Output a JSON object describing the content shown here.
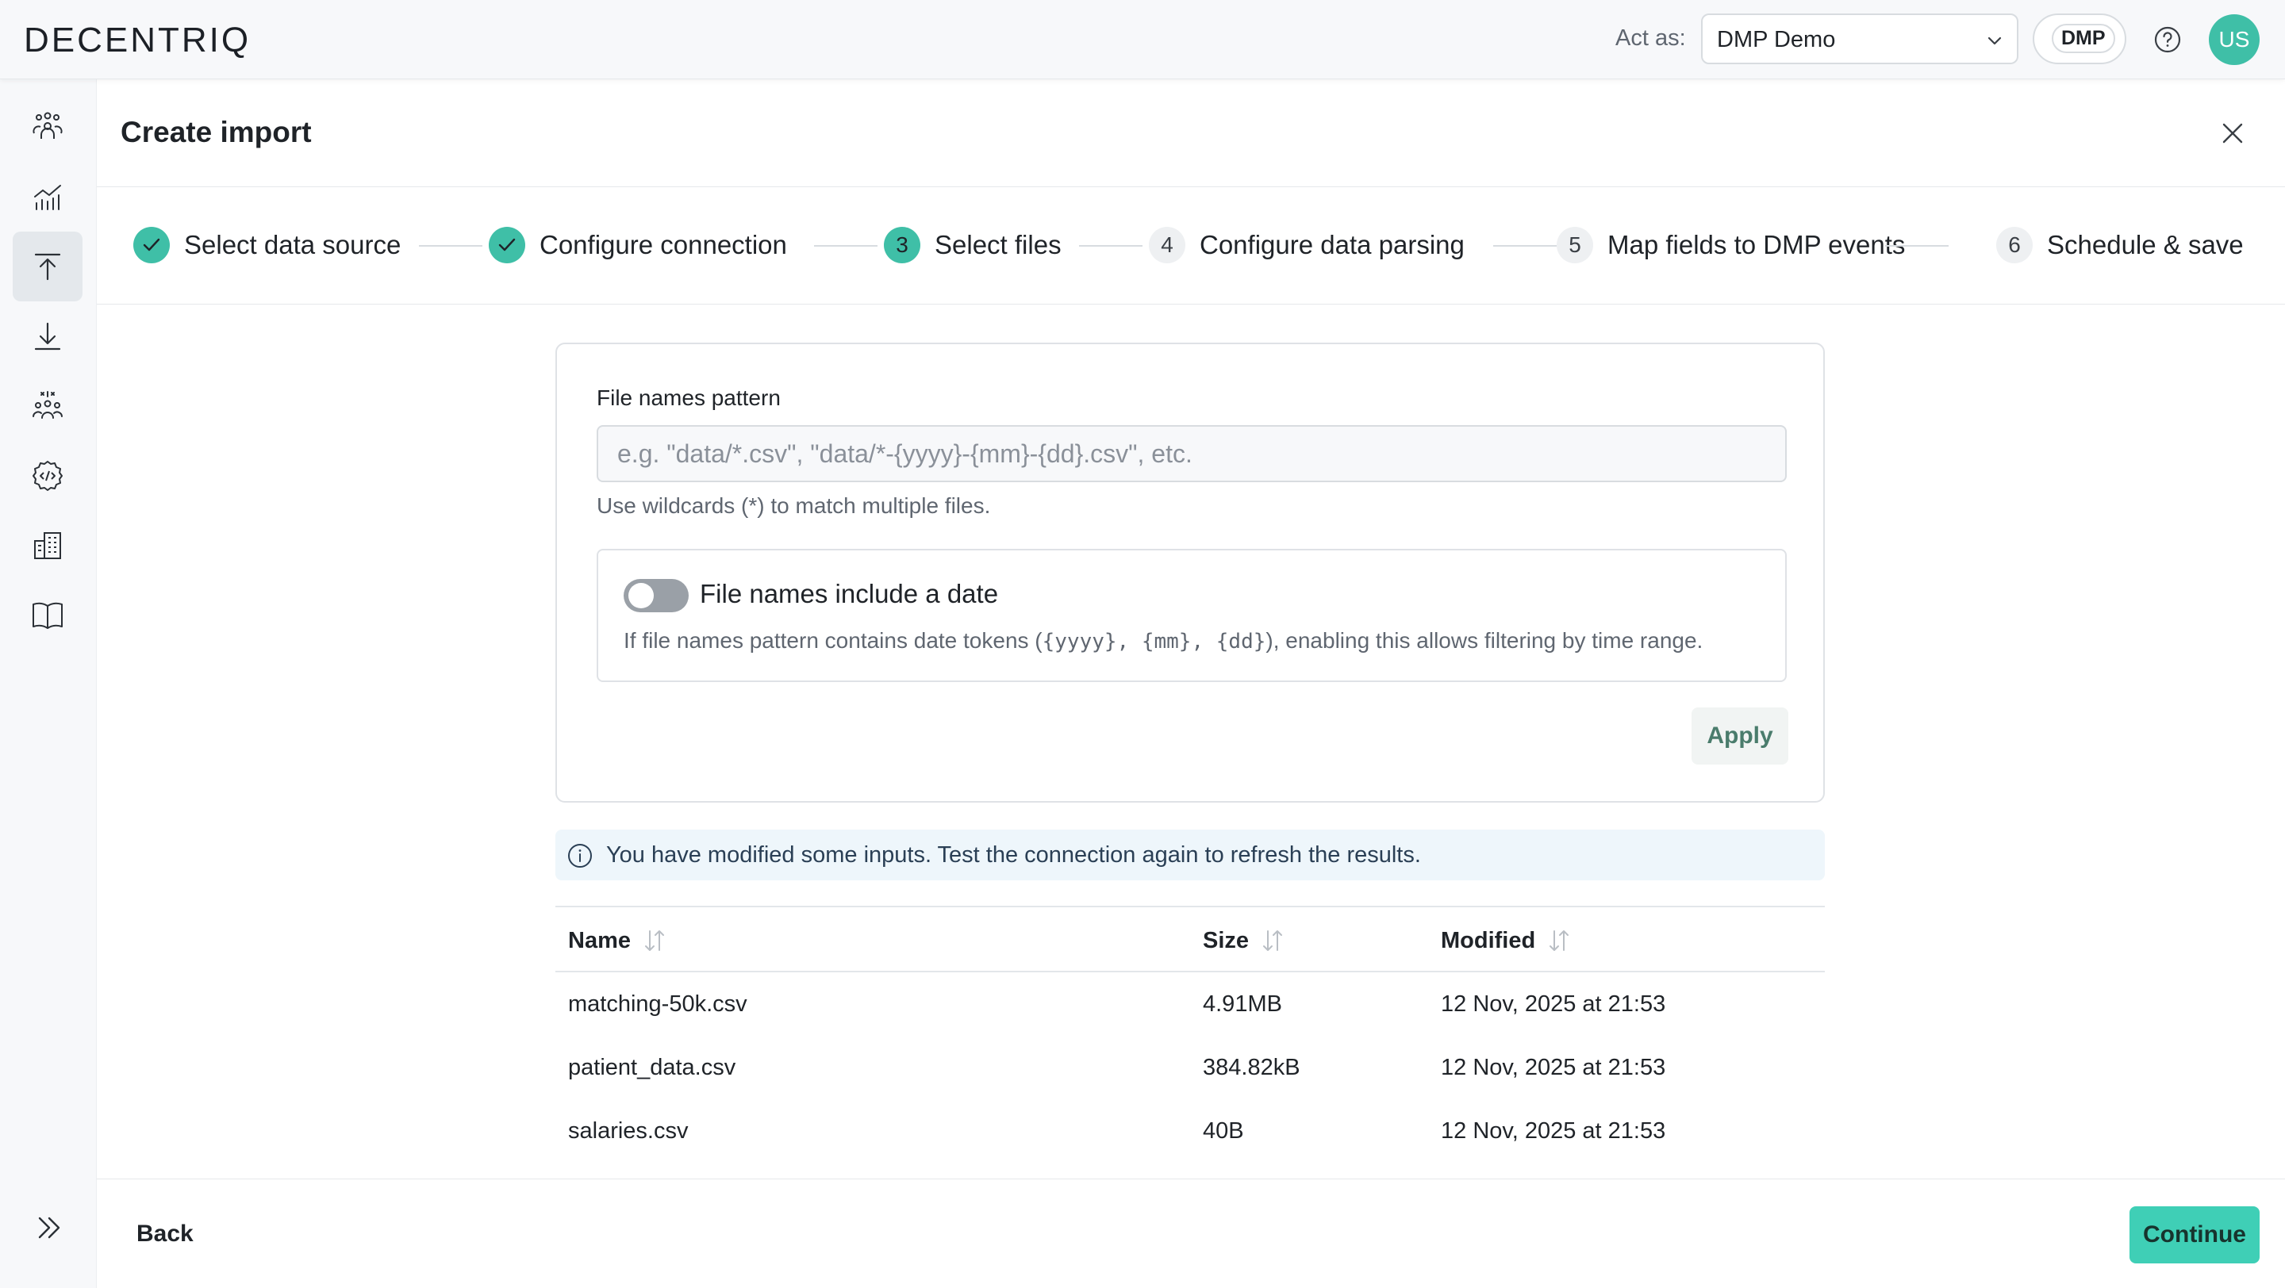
{
  "app": {
    "logo": "DECENTRIQ"
  },
  "topbar": {
    "act_as_label": "Act as:",
    "act_as_value": "DMP Demo",
    "badge": "DMP",
    "avatar_initials": "US"
  },
  "sidebar": {
    "items": [
      {
        "icon": "audiences-icon"
      },
      {
        "icon": "insights-chart-icon"
      },
      {
        "icon": "import-upload-icon",
        "active": true
      },
      {
        "icon": "export-download-icon"
      },
      {
        "icon": "people-group-icon"
      },
      {
        "icon": "settings-code-icon"
      },
      {
        "icon": "buildings-icon"
      },
      {
        "icon": "book-icon"
      }
    ],
    "expand_icon": "double-chevron-right-icon"
  },
  "header": {
    "title": "Create import"
  },
  "stepper": {
    "steps": [
      {
        "number": "1",
        "label": "Select data source",
        "status": "done"
      },
      {
        "number": "2",
        "label": "Configure connection",
        "status": "done"
      },
      {
        "number": "3",
        "label": "Select files",
        "status": "current"
      },
      {
        "number": "4",
        "label": "Configure data parsing",
        "status": "todo"
      },
      {
        "number": "5",
        "label": "Map fields to DMP events",
        "status": "todo"
      },
      {
        "number": "6",
        "label": "Schedule & save",
        "status": "todo"
      }
    ]
  },
  "form": {
    "pattern_label": "File names pattern",
    "pattern_value": "",
    "pattern_placeholder": "e.g. \"data/*.csv\", \"data/*-{yyyy}-{mm}-{dd}.csv\", etc.",
    "pattern_hint": "Use wildcards (*) to match multiple files.",
    "date_toggle_label": "File names include a date",
    "date_toggle_on": false,
    "date_toggle_desc_prefix": "If file names pattern contains date tokens (",
    "date_tokens": "{yyyy}, {mm}, {dd}",
    "date_toggle_desc_suffix": "), enabling this allows filtering by time range.",
    "apply_label": "Apply"
  },
  "info_banner": {
    "text": "You have modified some inputs. Test the connection again to refresh the results."
  },
  "files_table": {
    "columns": [
      "Name",
      "Size",
      "Modified"
    ],
    "rows": [
      {
        "name": "matching-50k.csv",
        "size": "4.91MB",
        "modified": "12 Nov, 2025 at 21:53"
      },
      {
        "name": "patient_data.csv",
        "size": "384.82kB",
        "modified": "12 Nov, 2025 at 21:53"
      },
      {
        "name": "salaries.csv",
        "size": "40B",
        "modified": "12 Nov, 2025 at 21:53"
      }
    ]
  },
  "footer": {
    "back_label": "Back",
    "continue_label": "Continue"
  },
  "colors": {
    "accent": "#3fbfa7",
    "continue_bg": "#3fcfb6",
    "info_bg": "#eef6fb"
  }
}
